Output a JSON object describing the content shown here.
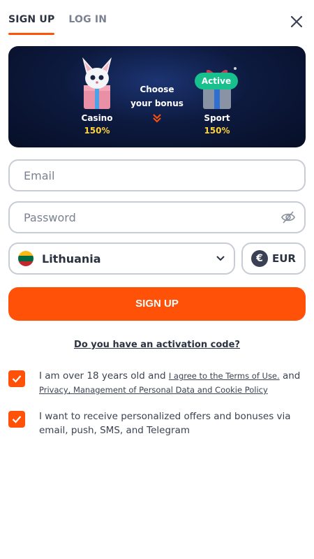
{
  "tabs": [
    {
      "label": "SIGN UP",
      "active": true
    },
    {
      "label": "LOG IN",
      "active": false
    }
  ],
  "banner": {
    "choose_line1": "Choose",
    "choose_line2": "your bonus",
    "bonuses": [
      {
        "label": "Casino",
        "percent": "150%"
      },
      {
        "label": "Sport",
        "percent": "150%",
        "badge": "Active"
      }
    ]
  },
  "form": {
    "email_placeholder": "Email",
    "password_placeholder": "Password",
    "country": "Lithuania",
    "currency": "EUR",
    "currency_symbol": "€",
    "submit_label": "SIGN UP",
    "activation_link": "Do you have an activation code?"
  },
  "consents": [
    {
      "checked": true,
      "text_before": "I am over 18 years old and ",
      "link1": "I agree to the Terms of Use.",
      "text_mid": " and ",
      "link2": "Privacy, Management of Personal Data and Cookie Policy"
    },
    {
      "checked": true,
      "text": "I want to receive personalized offers and bonuses via email, push, SMS, and Telegram"
    }
  ],
  "colors": {
    "accent": "#ff5108",
    "banner_bg": "#0d1a3f",
    "active_badge": "#17c08c",
    "percent": "#ffd23c"
  }
}
